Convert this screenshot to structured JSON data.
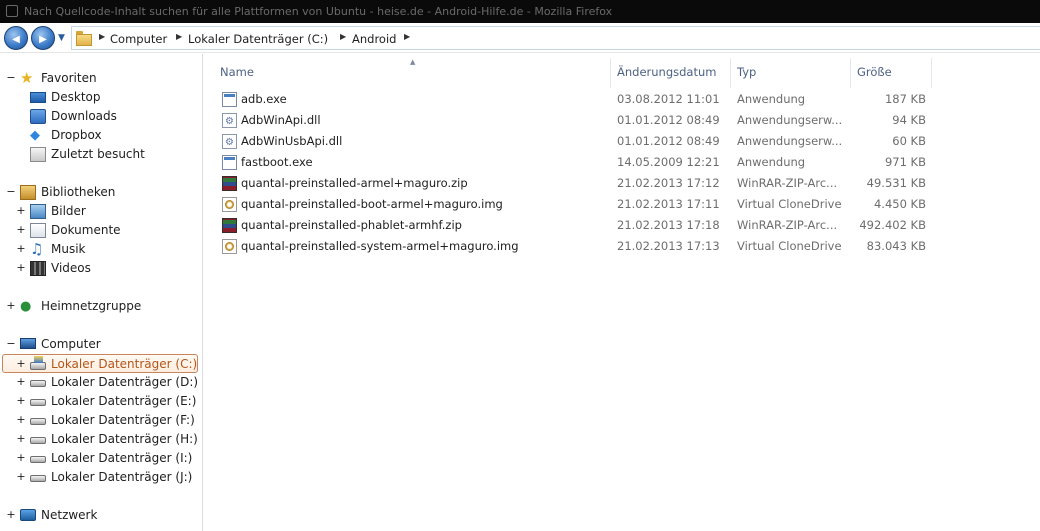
{
  "window": {
    "title": "Nach Quellcode-Inhalt suchen für alle Plattformen von Ubuntu - heise.de - Android-Hilfe.de - Mozilla Firefox"
  },
  "navbar": {
    "back_glyph": "◀",
    "forward_glyph": "▶",
    "history_glyph": "▼",
    "breadcrumb": [
      "Computer",
      "Lokaler Datenträger (C:)",
      "Android"
    ],
    "sep_glyph": "▶"
  },
  "tree": {
    "expanded_glyph": "−",
    "collapsed_glyph": "+",
    "favorites": {
      "label": "Favoriten",
      "items": [
        "Desktop",
        "Downloads",
        "Dropbox",
        "Zuletzt besucht"
      ]
    },
    "libraries": {
      "label": "Bibliotheken",
      "items": [
        "Bilder",
        "Dokumente",
        "Musik",
        "Videos"
      ]
    },
    "homegroup": {
      "label": "Heimnetzgruppe"
    },
    "computer": {
      "label": "Computer",
      "drives": [
        "Lokaler Datenträger (C:)",
        "Lokaler Datenträger (D:)",
        "Lokaler Datenträger (E:)",
        "Lokaler Datenträger (F:)",
        "Lokaler Datenträger (H:)",
        "Lokaler Datenträger (I:)",
        "Lokaler Datenträger (J:)"
      ],
      "selected_drive": "Lokaler Datenträger (C:)"
    },
    "network": {
      "label": "Netzwerk"
    }
  },
  "columns": {
    "name": "Name",
    "date": "Änderungsdatum",
    "type": "Typ",
    "size": "Größe",
    "sort_glyph": "▲"
  },
  "files": [
    {
      "name": "adb.exe",
      "date": "03.08.2012 11:01",
      "type": "Anwendung",
      "size": "187 KB",
      "icon": "exe-icon"
    },
    {
      "name": "AdbWinApi.dll",
      "date": "01.01.2012 08:49",
      "type": "Anwendungserw...",
      "size": "94 KB",
      "icon": "dll-icon"
    },
    {
      "name": "AdbWinUsbApi.dll",
      "date": "01.01.2012 08:49",
      "type": "Anwendungserw...",
      "size": "60 KB",
      "icon": "dll-icon"
    },
    {
      "name": "fastboot.exe",
      "date": "14.05.2009 12:21",
      "type": "Anwendung",
      "size": "971 KB",
      "icon": "exe-icon"
    },
    {
      "name": "quantal-preinstalled-armel+maguro.zip",
      "date": "21.02.2013 17:12",
      "type": "WinRAR-ZIP-Arc...",
      "size": "49.531 KB",
      "icon": "winrar-zip-icon"
    },
    {
      "name": "quantal-preinstalled-boot-armel+maguro.img",
      "date": "21.02.2013 17:11",
      "type": "Virtual CloneDrive",
      "size": "4.450 KB",
      "icon": "disc-image-icon"
    },
    {
      "name": "quantal-preinstalled-phablet-armhf.zip",
      "date": "21.02.2013 17:18",
      "type": "WinRAR-ZIP-Arc...",
      "size": "492.402 KB",
      "icon": "winrar-zip-icon"
    },
    {
      "name": "quantal-preinstalled-system-armel+maguro.img",
      "date": "21.02.2013 17:13",
      "type": "Virtual CloneDrive",
      "size": "83.043 KB",
      "icon": "disc-image-icon"
    }
  ]
}
